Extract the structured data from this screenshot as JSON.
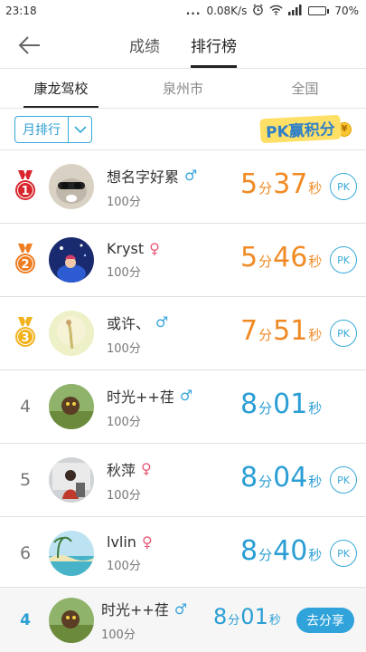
{
  "status_bar": {
    "time": "23:18",
    "dots": "...",
    "speed": "0.08K/s",
    "battery": "70%",
    "battery_level": 0.7
  },
  "header": {
    "tabs": [
      {
        "label": "成绩"
      },
      {
        "label": "排行榜"
      }
    ],
    "active_tab": "排行榜"
  },
  "scope_tabs": [
    {
      "label": "康龙驾校"
    },
    {
      "label": "泉州市"
    },
    {
      "label": "全国"
    }
  ],
  "filter": {
    "dropdown_label": "月排行",
    "promo_text": "PK赢积分",
    "coin_symbol": "¥"
  },
  "rows": [
    {
      "rank": "1",
      "name": "想名字好累",
      "gender": "♂",
      "score": "100分",
      "min": "5",
      "sec": "37",
      "min_unit": "分",
      "sec_unit": "秒",
      "pk": "PK"
    },
    {
      "rank": "2",
      "name": "Kryst",
      "gender": "♀",
      "score": "100分",
      "min": "5",
      "sec": "46",
      "min_unit": "分",
      "sec_unit": "秒",
      "pk": "PK"
    },
    {
      "rank": "3",
      "name": "或许、",
      "gender": "♂",
      "score": "100分",
      "min": "7",
      "sec": "51",
      "min_unit": "分",
      "sec_unit": "秒",
      "pk": "PK"
    },
    {
      "rank": "4",
      "name": "时光++荏",
      "gender": "♂",
      "score": "100分",
      "min": "8",
      "sec": "01",
      "min_unit": "分",
      "sec_unit": "秒"
    },
    {
      "rank": "5",
      "name": "秋萍",
      "gender": "♀",
      "score": "100分",
      "min": "8",
      "sec": "04",
      "min_unit": "分",
      "sec_unit": "秒",
      "pk": "PK"
    },
    {
      "rank": "6",
      "name": "lvlin",
      "gender": "♀",
      "score": "100分",
      "min": "8",
      "sec": "40",
      "min_unit": "分",
      "sec_unit": "秒",
      "pk": "PK"
    }
  ],
  "me": {
    "rank": "4",
    "name": "时光++荏",
    "gender": "♂",
    "score": "100分",
    "min": "8",
    "sec": "01",
    "min_unit": "分",
    "sec_unit": "秒",
    "share_label": "去分享"
  },
  "colors": {
    "accent": "#2a9ed4",
    "orange": "#f08a24",
    "male": "#3aa5dc",
    "female": "#e65a77",
    "gold": "#f2b21b",
    "red_medal": "#d8262c"
  }
}
